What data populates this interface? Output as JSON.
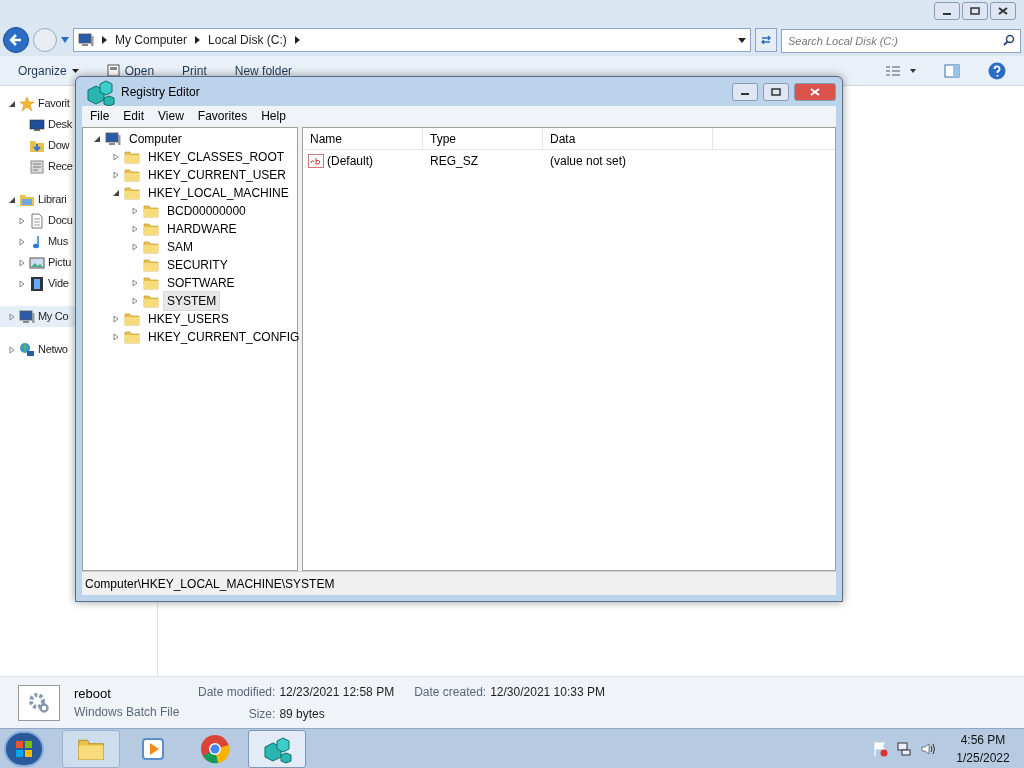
{
  "explorer": {
    "address": [
      "My Computer",
      "Local Disk (C:)"
    ],
    "search": {
      "placeholder": "Search Local Disk (C:)"
    },
    "toolbar": [
      {
        "label": "Organize",
        "kind": "menu"
      },
      {
        "label": "Open",
        "kind": "icon"
      },
      {
        "label": "Print",
        "kind": "plain"
      },
      {
        "label": "New folder",
        "kind": "plain"
      }
    ],
    "nav": [
      {
        "label": "Favorit",
        "kind": "branch",
        "expanded": true,
        "highlighted": false,
        "children": [
          {
            "label": "Desk",
            "kind": "leaf",
            "highlighted": false
          },
          {
            "label": "Dow",
            "kind": "leaf",
            "highlighted": false
          },
          {
            "label": "Rece",
            "kind": "leaf",
            "highlighted": false
          }
        ]
      },
      {
        "label": "Librari",
        "kind": "branch",
        "expanded": true,
        "highlighted": false,
        "children": [
          {
            "label": "Docu",
            "kind": "branch",
            "expanded": false,
            "highlighted": false
          },
          {
            "label": "Mus",
            "kind": "branch",
            "expanded": false,
            "highlighted": false
          },
          {
            "label": "Pictu",
            "kind": "branch",
            "expanded": false,
            "highlighted": false
          },
          {
            "label": "Vide",
            "kind": "branch",
            "expanded": false,
            "highlighted": false
          }
        ]
      },
      {
        "label": "My Co",
        "kind": "branch",
        "expanded": false,
        "highlighted": true
      },
      {
        "label": "Netwo",
        "kind": "branch",
        "expanded": false,
        "highlighted": false
      }
    ],
    "details": {
      "name": "reboot",
      "type": "Windows Batch File",
      "fields": [
        {
          "label": "Date modified:",
          "value": "12/23/2021 12:58 PM"
        },
        {
          "label": "Date created:",
          "value": "12/30/2021 10:33 PM"
        },
        {
          "label": "Size:",
          "value": "89 bytes"
        }
      ]
    }
  },
  "regedit": {
    "title": "Registry Editor",
    "menu": [
      "File",
      "Edit",
      "View",
      "Favorites",
      "Help"
    ],
    "tree": [
      {
        "label": "Computer",
        "kind": "branch",
        "expanded": true,
        "selected": false,
        "children": [
          {
            "label": "HKEY_CLASSES_ROOT",
            "kind": "branch",
            "expanded": false,
            "selected": false
          },
          {
            "label": "HKEY_CURRENT_USER",
            "kind": "branch",
            "expanded": false,
            "selected": false
          },
          {
            "label": "HKEY_LOCAL_MACHINE",
            "kind": "branch",
            "expanded": true,
            "selected": false,
            "children": [
              {
                "label": "BCD00000000",
                "kind": "branch",
                "expanded": false,
                "selected": false
              },
              {
                "label": "HARDWARE",
                "kind": "branch",
                "expanded": false,
                "selected": false
              },
              {
                "label": "SAM",
                "kind": "branch",
                "expanded": false,
                "selected": false
              },
              {
                "label": "SECURITY",
                "kind": "leaf",
                "selected": false
              },
              {
                "label": "SOFTWARE",
                "kind": "branch",
                "expanded": false,
                "selected": false
              },
              {
                "label": "SYSTEM",
                "kind": "branch",
                "expanded": false,
                "selected": true
              }
            ]
          },
          {
            "label": "HKEY_USERS",
            "kind": "branch",
            "expanded": false,
            "selected": false
          },
          {
            "label": "HKEY_CURRENT_CONFIG",
            "kind": "branch",
            "expanded": false,
            "selected": false
          }
        ]
      }
    ],
    "columns": [
      "Name",
      "Type",
      "Data"
    ],
    "values": [
      {
        "name": "(Default)",
        "type": "REG_SZ",
        "data": "(value not set)"
      }
    ],
    "status": "Computer\\HKEY_LOCAL_MACHINE\\SYSTEM"
  },
  "taskbar": {
    "items": [
      {
        "active": false
      },
      {
        "active": false
      },
      {
        "active": false
      },
      {
        "active": true
      }
    ],
    "time": "4:56 PM",
    "date": "1/25/2022"
  }
}
